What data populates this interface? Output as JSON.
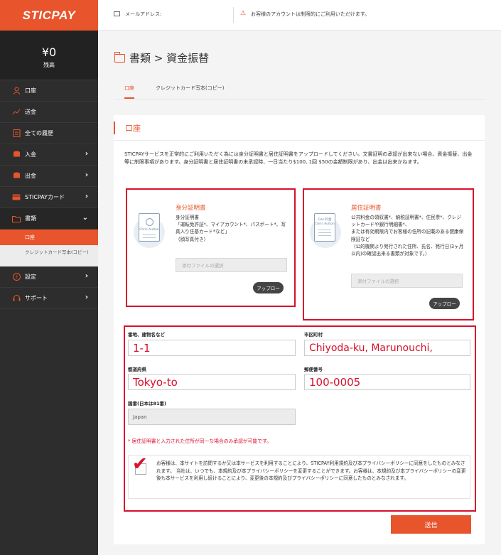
{
  "brand": {
    "logo": "STICPAY",
    "accent": "#e8542b",
    "highlight": "#d7102b"
  },
  "balance": {
    "amount": "¥0",
    "label": "残高"
  },
  "sidebar": {
    "items": [
      {
        "label": "口座",
        "icon": "user-icon"
      },
      {
        "label": "送金",
        "icon": "chart-icon"
      },
      {
        "label": "全ての履歴",
        "icon": "list-icon"
      },
      {
        "label": "入金",
        "icon": "database-icon"
      },
      {
        "label": "出金",
        "icon": "database-icon"
      },
      {
        "label": "STICPAYカード",
        "icon": "card-icon"
      },
      {
        "label": "書類",
        "icon": "folder-icon"
      },
      {
        "label": "設定",
        "icon": "question-icon"
      },
      {
        "label": "サポート",
        "icon": "headset-icon"
      }
    ],
    "sub_active": "口座",
    "sub_item": "クレジットカード写本(コピー)"
  },
  "topbar": {
    "email_label": "メールアドレス:",
    "warning": "お客様のアカウントは制限的にご利用いただけます。"
  },
  "page": {
    "title": "書類 > 資金振替",
    "tabs": [
      "口座",
      "クレジットカード写本(コピー)"
    ]
  },
  "card": {
    "title": "口座",
    "notice": "STICPAYサービスを正常的にご利用いただく為には身分証明書と居住証明書をアップロードしてください。文書証明の承認が出来ない場合、資金振替、出金等に制限事項があります。身分証明書と居住証明書の未承認時、一日当たり$100, 1回 $50の金額制限があり、出金は出来かねます。",
    "id_doc": {
      "title": "身分証明書",
      "desc": "身分証明書\n「運転免許証*、マイアカウント*、パスポート*、写真入り住基カード*など」\n（顔写真付き）",
      "file_placeholder": "添付ファイルの選択",
      "upload": "アップロー",
      "card_name": "Chris Aulton"
    },
    "res_doc": {
      "title": "居住証明書",
      "desc": "公共料金の領収書*、納税証明書*、住民票*、クレジットカードや銀行明細書*、\nまたは有効期限内でお客様の住所の記載のある健康保険証など\n（公的機関より発行された住所、氏名、発行日(3ヶ月以内)の確認出来る書類が対象です。）",
      "file_placeholder": "添付ファイルの選択",
      "upload": "アップロー",
      "card_small": "Gas 料金",
      "card_name": "Chris Aulton"
    },
    "address": {
      "street_label": "番地、建物名など",
      "street_value": "1-1",
      "city_label": "市区町村",
      "city_value": "Chiyoda-ku, Marunouchi,",
      "prefecture_label": "都道府県",
      "prefecture_value": "Tokyo-to",
      "zip_label": "郵便番号",
      "zip_value": "100-0005",
      "country_label": "国番(日本は81番)",
      "country_value": "Japan"
    },
    "address_note": "* 居住証明書と入力された住所が同一な場合のみ承認が可能です。",
    "agree_text": "お客様は、本サイトを訪問するか又は本サービスを利用することにより、STICPAY利用規約及び本プライバシーポリシーに同意をしたものとみなされます。 当社は、いつでも、本規約及び本プライバシーポリシーを変更することができます。お客様は、本規約及び本プライバシーポリシーの変更後も本サービスを利用し続けることにより、変更後の本規約及びプライバシーポリシーに同意したものとみなされます。",
    "submit": "送信"
  }
}
